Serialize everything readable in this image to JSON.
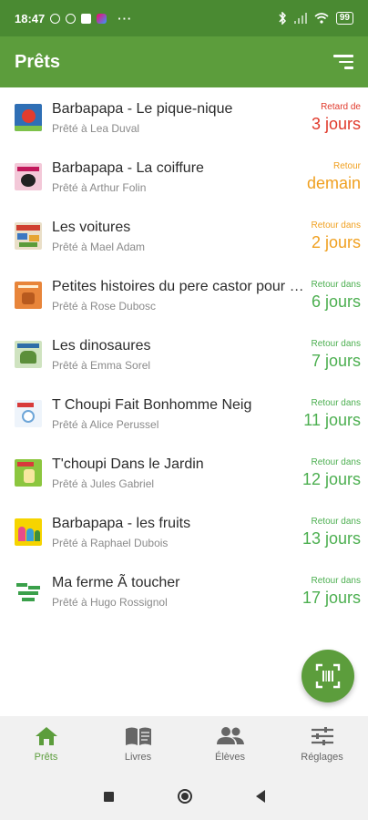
{
  "status_bar": {
    "time": "18:47",
    "more": "···",
    "battery": "99"
  },
  "app_bar": {
    "title": "Prêts",
    "sort_icon": "sort-icon"
  },
  "loans": [
    {
      "title": "Barbapapa - Le pique-nique",
      "borrower": "Prêté à Lea Duval",
      "due_label": "Retard de",
      "due_value": "3 jours",
      "status": "red"
    },
    {
      "title": "Barbapapa - La coiffure",
      "borrower": "Prêté à Arthur Folin",
      "due_label": "Retour",
      "due_value": "demain",
      "status": "orange"
    },
    {
      "title": "Les voitures",
      "borrower": "Prêté à Mael Adam",
      "due_label": "Retour dans",
      "due_value": "2 jours",
      "status": "orange"
    },
    {
      "title": "Petites histoires du pere castor pour …",
      "borrower": "Prêté à Rose Dubosc",
      "due_label": "Retour dans",
      "due_value": "6 jours",
      "status": "green"
    },
    {
      "title": "Les dinosaures",
      "borrower": "Prêté à Emma Sorel",
      "due_label": "Retour dans",
      "due_value": "7 jours",
      "status": "green"
    },
    {
      "title": "T Choupi Fait Bonhomme Neig",
      "borrower": "Prêté à Alice Perussel",
      "due_label": "Retour dans",
      "due_value": "11 jours",
      "status": "green"
    },
    {
      "title": "T'choupi Dans le Jardin",
      "borrower": "Prêté à Jules Gabriel",
      "due_label": "Retour dans",
      "due_value": "12 jours",
      "status": "green"
    },
    {
      "title": "Barbapapa - les fruits",
      "borrower": "Prêté à Raphael Dubois",
      "due_label": "Retour dans",
      "due_value": "13 jours",
      "status": "green"
    },
    {
      "title": "Ma ferme Ã  toucher",
      "borrower": "Prêté à Hugo Rossignol",
      "due_label": "Retour dans",
      "due_value": "17 jours",
      "status": "green"
    }
  ],
  "fab": {
    "icon": "barcode-scan-icon"
  },
  "bottom_nav": [
    {
      "label": "Prêts",
      "icon": "home-icon",
      "active": true
    },
    {
      "label": "Livres",
      "icon": "book-icon",
      "active": false
    },
    {
      "label": "Élèves",
      "icon": "people-icon",
      "active": false
    },
    {
      "label": "Réglages",
      "icon": "sliders-icon",
      "active": false
    }
  ],
  "colors": {
    "primary": "#5c9d3c",
    "status_bar": "#4a8a32",
    "late": "#e0392b",
    "soon": "#f0a020",
    "ok": "#4caf50"
  }
}
